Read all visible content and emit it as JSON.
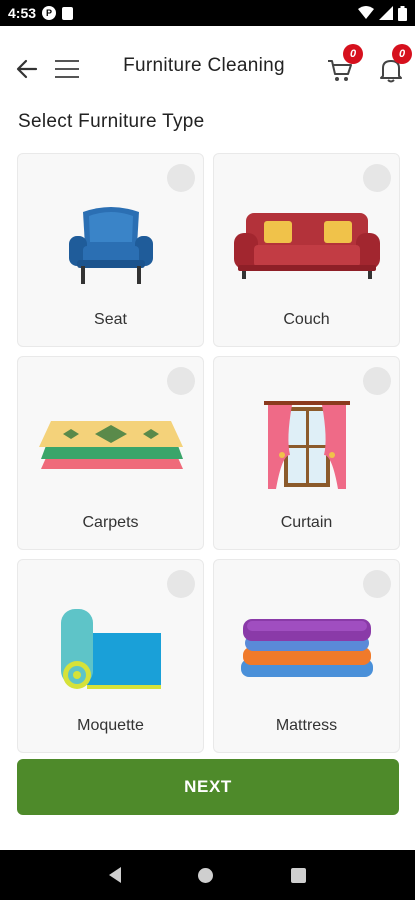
{
  "status_bar": {
    "time": "4:53"
  },
  "header": {
    "title": "Furniture Cleaning",
    "cart_badge": "0",
    "notification_badge": "0"
  },
  "section_title": "Select Furniture Type",
  "furniture_items": [
    {
      "label": "Seat",
      "icon": "armchair-icon"
    },
    {
      "label": "Couch",
      "icon": "sofa-icon"
    },
    {
      "label": "Carpets",
      "icon": "carpet-icon"
    },
    {
      "label": "Curtain",
      "icon": "curtain-icon"
    },
    {
      "label": "Moquette",
      "icon": "moquette-roll-icon"
    },
    {
      "label": "Mattress",
      "icon": "mattress-stack-icon"
    }
  ],
  "next_button": {
    "label": "NEXT"
  },
  "colors": {
    "accent": "#4e8a2a",
    "badge": "#d6101d"
  }
}
